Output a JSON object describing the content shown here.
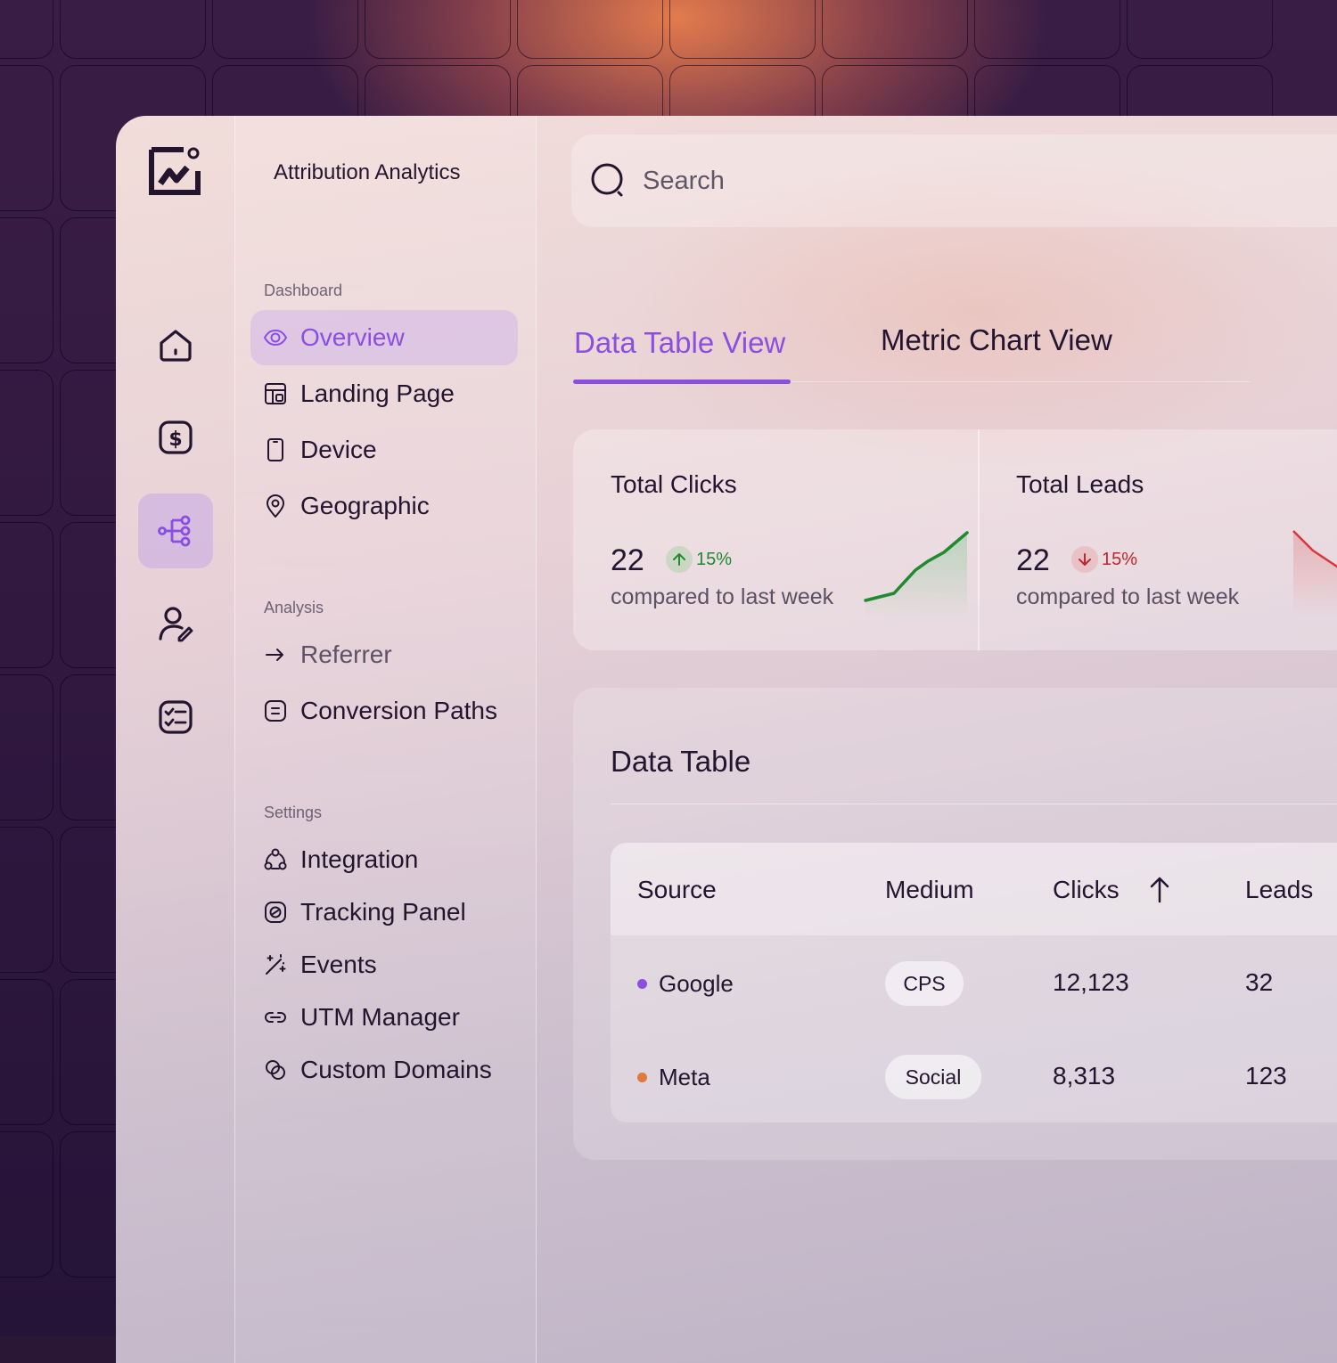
{
  "app": {
    "title": "Attribution Analytics"
  },
  "rail": {
    "items": [
      {
        "icon": "home-icon"
      },
      {
        "icon": "dollar-icon"
      },
      {
        "icon": "workflow-icon",
        "active": true
      },
      {
        "icon": "user-edit-icon"
      },
      {
        "icon": "checklist-icon"
      }
    ]
  },
  "sidebar": {
    "sections": [
      {
        "label": "Dashboard",
        "items": [
          {
            "label": "Overview",
            "icon": "eye-icon",
            "active": true
          },
          {
            "label": "Landing Page",
            "icon": "layout-icon"
          },
          {
            "label": "Device",
            "icon": "device-icon"
          },
          {
            "label": "Geographic",
            "icon": "location-pin-icon"
          }
        ]
      },
      {
        "label": "Analysis",
        "items": [
          {
            "label": "Referrer",
            "icon": "arrow-right-icon"
          },
          {
            "label": "Conversion Paths",
            "icon": "list-box-icon"
          }
        ]
      },
      {
        "label": "Settings",
        "items": [
          {
            "label": "Integration",
            "icon": "nodes-icon"
          },
          {
            "label": "Tracking Panel",
            "icon": "tracking-icon"
          },
          {
            "label": "Events",
            "icon": "magic-wand-icon"
          },
          {
            "label": "UTM Manager",
            "icon": "link-icon"
          },
          {
            "label": "Custom Domains",
            "icon": "domain-icon"
          }
        ]
      }
    ]
  },
  "search": {
    "placeholder": "Search"
  },
  "tabs": [
    {
      "label": "Data Table View",
      "active": true
    },
    {
      "label": "Metric Chart View",
      "active": false
    }
  ],
  "metrics": [
    {
      "title": "Total Clicks",
      "value": "22",
      "change": "15%",
      "direction": "up",
      "subtitle": "compared to last week",
      "color": "#1f8a2e"
    },
    {
      "title": "Total Leads",
      "value": "22",
      "change": "15%",
      "direction": "down",
      "subtitle": "compared to last week",
      "color": "#d9363e"
    }
  ],
  "table": {
    "title": "Data Table",
    "columns": [
      "Source",
      "Medium",
      "Clicks",
      "Leads"
    ],
    "sort_column": "Clicks",
    "rows": [
      {
        "source": "Google",
        "dot_color": "#8a4fe0",
        "medium": "CPS",
        "clicks": "12,123",
        "leads": "32"
      },
      {
        "source": "Meta",
        "dot_color": "#e07a3c",
        "medium": "Social",
        "clicks": "8,313",
        "leads": "123"
      }
    ]
  },
  "colors": {
    "accent": "#8a4fe0",
    "positive": "#1f8a2e",
    "negative": "#c0262d"
  }
}
